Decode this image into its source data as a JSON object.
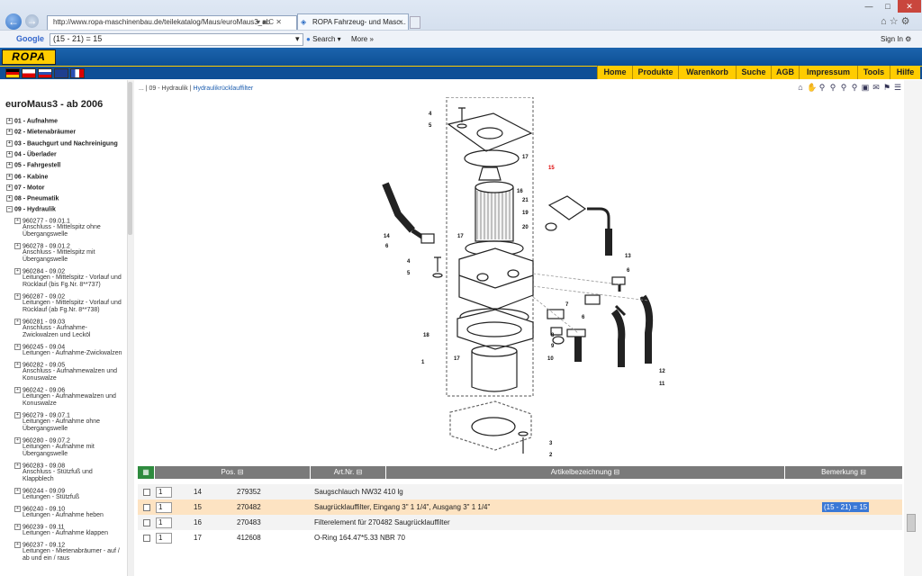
{
  "browser": {
    "url": "http://www.ropa-maschinenbau.de/teilekatalog/Maus/euroMaus3_ab",
    "tab_title": "ROPA Fahrzeug- und Masc...",
    "search_engine": "Google",
    "search_query": "(15 - 21) = 15",
    "search_button": "Search",
    "more_button": "More",
    "sign_in": "Sign In"
  },
  "nav": {
    "items": [
      "Home",
      "Produkte",
      "Warenkorb",
      "Suche",
      "AGB",
      "Impressum",
      "Tools",
      "Hilfe"
    ]
  },
  "logo_text": "ROPA",
  "sidebar": {
    "title": "euroMaus3 - ab 2006",
    "groups": [
      "01 - Aufnahme",
      "02 - Mietenabräumer",
      "03 - Bauchgurt und Nachreinigung",
      "04 - Überlader",
      "05 - Fahrgestell",
      "06 - Kabine",
      "07 - Motor",
      "08 - Pneumatik",
      "09 - Hydraulik"
    ],
    "subitems": [
      {
        "code": "960277 - 09.01.1",
        "desc": [
          "Anschluss - Mittelspitz ohne",
          "Übergangswelle"
        ]
      },
      {
        "code": "960278 - 09.01.2",
        "desc": [
          "Anschluss - Mittelspitz mit",
          "Übergangswelle"
        ]
      },
      {
        "code": "960284 - 09.02",
        "desc": [
          "Leitungen - Mittelspitz - Vorlauf und",
          "Rücklauf (bis Fg.Nr. 8**737)"
        ]
      },
      {
        "code": "960287 - 09.02",
        "desc": [
          "Leitungen - Mittelspitz - Vorlauf und",
          "Rücklauf (ab Fg.Nr. 8**738)"
        ]
      },
      {
        "code": "960281 - 09.03",
        "desc": [
          "Anschluss - Aufnahme-",
          "Zwickwalzen und Lecköl"
        ]
      },
      {
        "code": "960245 - 09.04",
        "desc": [
          "Leitungen - Aufnahme-Zwickwalzen"
        ]
      },
      {
        "code": "960282 - 09.05",
        "desc": [
          "Anschluss - Aufnahmewalzen und",
          "Konuswalze"
        ]
      },
      {
        "code": "960242 - 09.06",
        "desc": [
          "Leitungen - Aufnahmewalzen und",
          "Konuswalze"
        ]
      },
      {
        "code": "960279 - 09.07.1",
        "desc": [
          "Leitungen - Aufnahme ohne",
          "Übergangswelle"
        ]
      },
      {
        "code": "960280 - 09.07.2",
        "desc": [
          "Leitungen - Aufnahme mit",
          "Übergangswelle"
        ]
      },
      {
        "code": "960283 - 09.08",
        "desc": [
          "Anschluss - Stützfuß und",
          "Klappblech"
        ]
      },
      {
        "code": "960244 - 09.09",
        "desc": [
          "Leitungen - Stützfuß"
        ]
      },
      {
        "code": "960240 - 09.10",
        "desc": [
          "Leitungen - Aufnahme heben"
        ]
      },
      {
        "code": "960239 - 09.11",
        "desc": [
          "Leitungen - Aufnahme klappen"
        ]
      },
      {
        "code": "960237 - 09.12",
        "desc": [
          "Leitungen - Mietenabräumer - auf /",
          "ab und ein / raus"
        ]
      }
    ]
  },
  "breadcrumb": {
    "prefix": "... | 09 - Hydraulik | ",
    "current": "Hydraulikrücklauffilter"
  },
  "diagram_labels": {
    "n1": "1",
    "n2": "2",
    "n3": "3",
    "n4": "4",
    "n5": "5",
    "n6": "6",
    "n7": "7",
    "n8": "8",
    "n9": "9",
    "n10": "10",
    "n11": "11",
    "n12": "12",
    "n13": "13",
    "n14": "14",
    "n15": "15",
    "n16": "16",
    "n17": "17",
    "n18": "18",
    "n19": "19",
    "n20": "20",
    "n21": "21"
  },
  "table": {
    "headers": {
      "pos": "Pos.",
      "art": "Art.Nr.",
      "desc": "Artikelbezeichnung",
      "rem": "Bemerkung"
    },
    "rows": [
      {
        "qty": "1",
        "pos": "14",
        "art": "279352",
        "desc": "Saugschlauch NW32 410 lg",
        "rem": ""
      },
      {
        "qty": "1",
        "pos": "15",
        "art": "270482",
        "desc": "Saugrücklauffilter, Eingang 3\" 1 1/4\", Ausgang 3\" 1 1/4\"",
        "rem": "(15 - 21) = 15"
      },
      {
        "qty": "1",
        "pos": "16",
        "art": "270483",
        "desc": "Filterelement für 270482 Saugrücklauffilter",
        "rem": ""
      },
      {
        "qty": "1",
        "pos": "17",
        "art": "412608",
        "desc": "O-Ring 164.47*5.33 NBR 70",
        "rem": ""
      }
    ]
  },
  "colors": {
    "accent": "#ffcc00",
    "nav_blue": "#0f4f96",
    "highlight_row": "#fde3c2",
    "selection": "#3a78d6"
  }
}
